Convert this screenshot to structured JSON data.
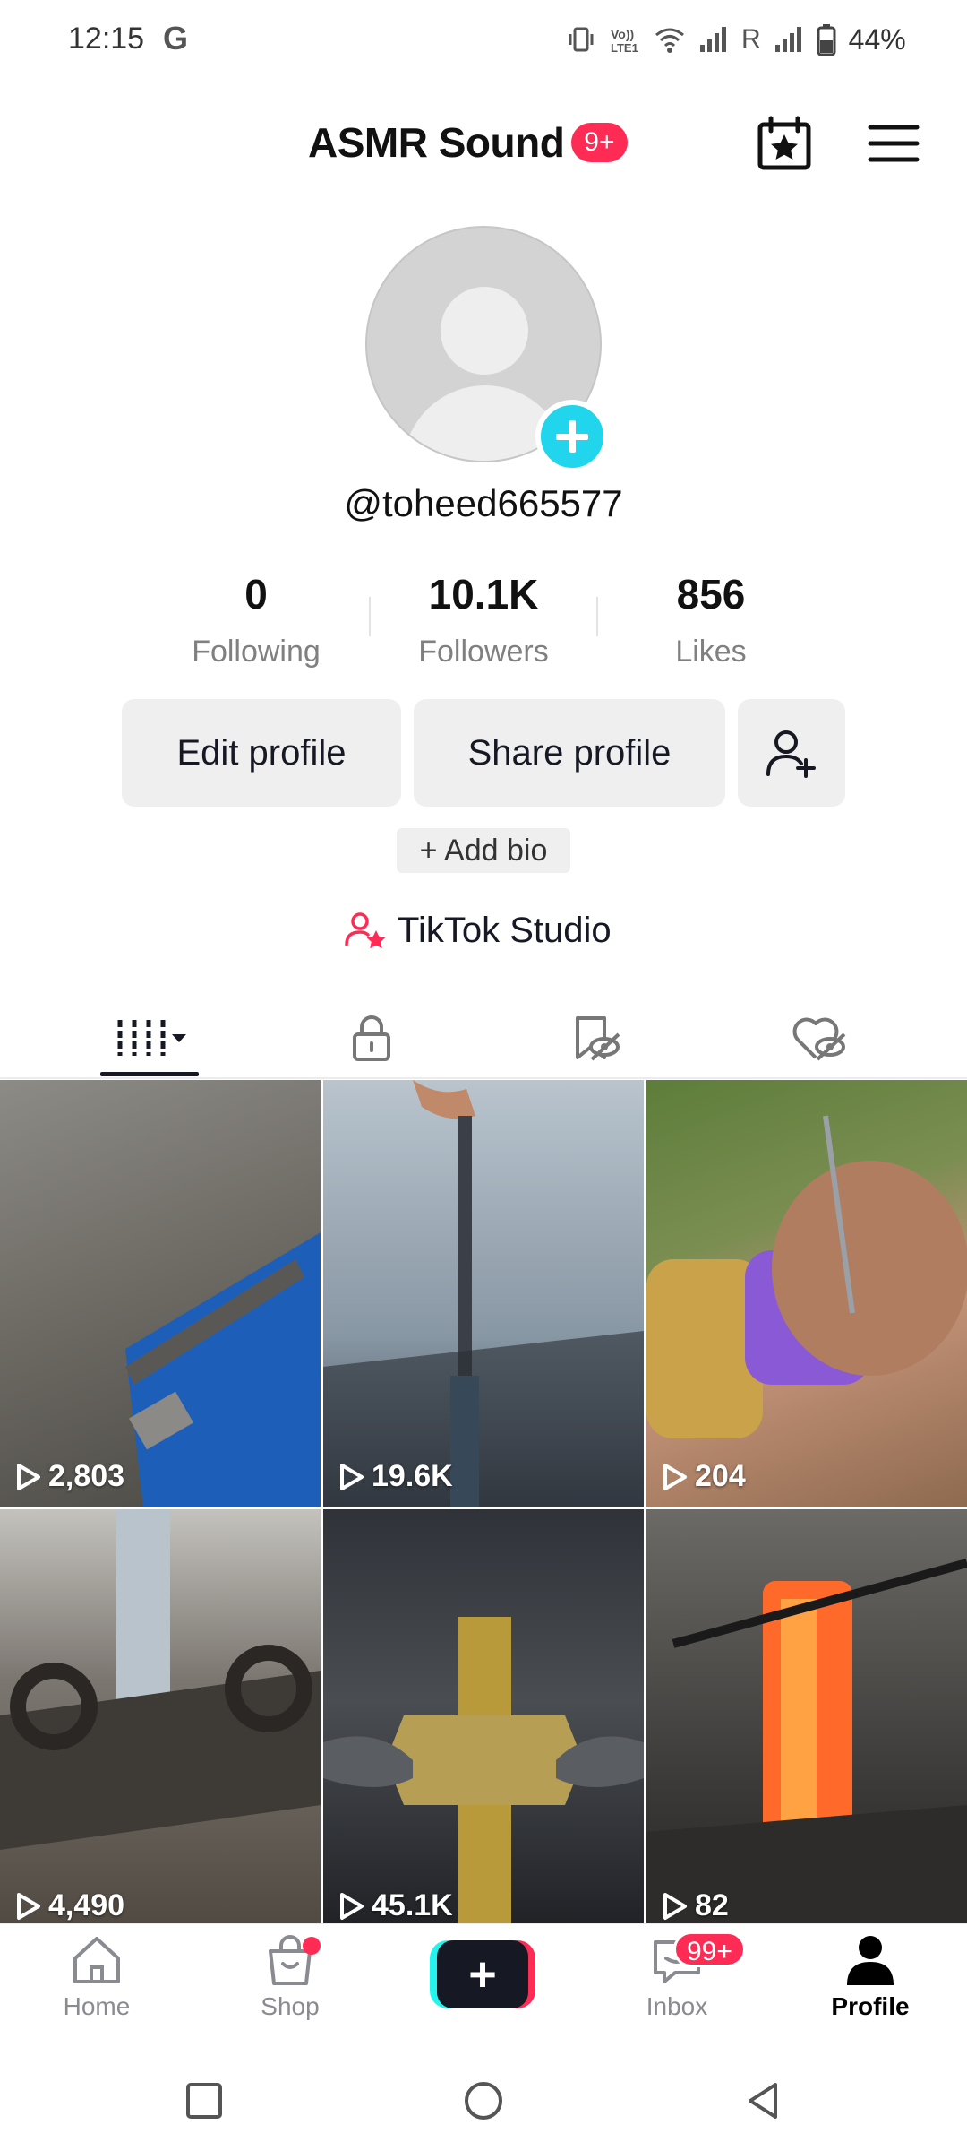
{
  "status_bar": {
    "time": "12:15",
    "g_icon": "G",
    "network": "R",
    "battery": "44%"
  },
  "header": {
    "title": "ASMR Sound",
    "badge": "9+"
  },
  "profile": {
    "username": "@toheed665577"
  },
  "stats": {
    "following_value": "0",
    "following_label": "Following",
    "followers_value": "10.1K",
    "followers_label": "Followers",
    "likes_value": "856",
    "likes_label": "Likes"
  },
  "actions": {
    "edit_profile": "Edit profile",
    "share_profile": "Share profile",
    "add_bio": "+ Add bio"
  },
  "studio": {
    "label": "TikTok Studio"
  },
  "tabs": [
    {
      "name": "videos",
      "icon": "grid-icon",
      "active": true
    },
    {
      "name": "private",
      "icon": "lock-icon",
      "active": false
    },
    {
      "name": "favorites",
      "icon": "bookmark-hidden-icon",
      "active": false
    },
    {
      "name": "liked",
      "icon": "heart-hidden-icon",
      "active": false
    }
  ],
  "videos": [
    {
      "views": "2,803"
    },
    {
      "views": "19.6K"
    },
    {
      "views": "204"
    },
    {
      "views": "4,490"
    },
    {
      "views": "45.1K"
    },
    {
      "views": "82"
    }
  ],
  "bottom_nav": {
    "home": "Home",
    "shop": "Shop",
    "create": "+",
    "inbox": "Inbox",
    "inbox_badge": "99+",
    "profile": "Profile"
  },
  "colors": {
    "accent_red": "#fe2c55",
    "accent_cyan": "#25f4ee",
    "avatar_add": "#20d5ec",
    "text_primary": "#161823",
    "text_secondary": "#808080"
  }
}
